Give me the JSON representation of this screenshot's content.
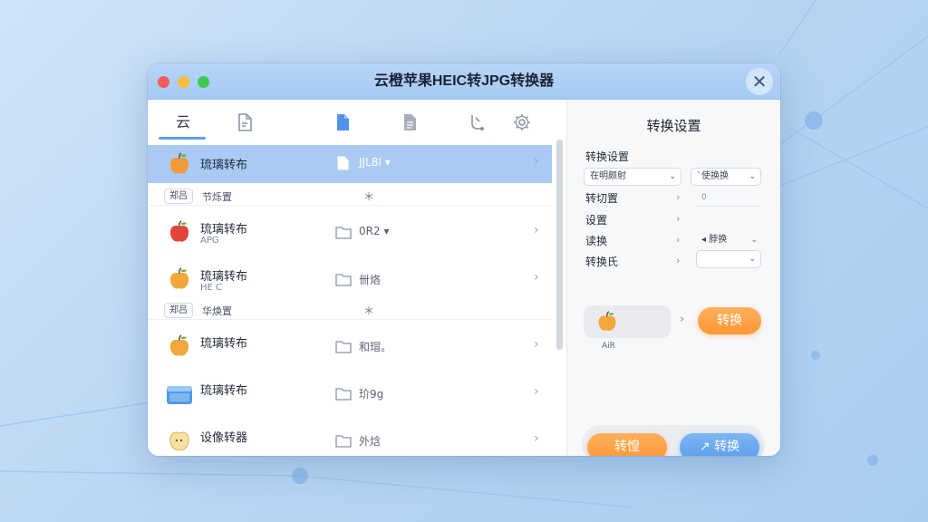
{
  "window": {
    "title": "云橙苹果HEIC转JPG转换器",
    "close_glyph": "✕"
  },
  "toolbar": {
    "first_tab_label": "云",
    "icons": [
      "doc-icon",
      "file-blue-icon",
      "file-gray-icon",
      "flow-icon",
      "gear-icon"
    ]
  },
  "files": [
    {
      "name": "琉璃转布",
      "sub": "",
      "meta": "JJL8I",
      "meta_caret": "▾",
      "selected": true,
      "folder": "file"
    },
    {
      "group": true,
      "badge": "郑吕",
      "label": "节烁置",
      "star": "＊"
    },
    {
      "name": "琉璃转布",
      "sub": "APG",
      "meta": "0R2",
      "meta_caret": "▾",
      "folder": "folder"
    },
    {
      "name": "琉璃转布",
      "sub": "HE C",
      "meta": "卌烙",
      "folder": "folder"
    },
    {
      "group": true,
      "badge": "郑吕",
      "label": "华焕置",
      "star": "＊"
    },
    {
      "name": "琉璃转布",
      "sub": "",
      "meta": "和瑁。",
      "folder": "folder"
    },
    {
      "name": "琉璃转布",
      "sub": "",
      "meta": "玠9g",
      "folder": "folder"
    },
    {
      "name": "设像转器",
      "sub": "",
      "meta": "外焓",
      "folder": "folder"
    }
  ],
  "chevron": "›",
  "panel": {
    "title": "转换设置",
    "section_label": "转换设置",
    "select_left": "在明颇射",
    "select_right": "`使换换",
    "caret": "⌄",
    "options": [
      {
        "label": "转切置",
        "chev": "›",
        "value": "0"
      },
      {
        "label": "设置",
        "chev": "›",
        "value": ""
      },
      {
        "label": "读换",
        "chev": "›",
        "value": "◂ 脖换"
      },
      {
        "label": "转换氏",
        "chev": "›",
        "value": ""
      }
    ],
    "preview_caption": "AiR",
    "preview_arrow": "›",
    "convert_button": "转换",
    "bottom_orange_button": "转惶",
    "bottom_blue_button": "↗ 转换"
  },
  "colors": {
    "accent_blue": "#5aa0ee",
    "selected_row": "#a9cbf3",
    "orange": "#ff9733",
    "titlebar": "#a6caf3"
  }
}
